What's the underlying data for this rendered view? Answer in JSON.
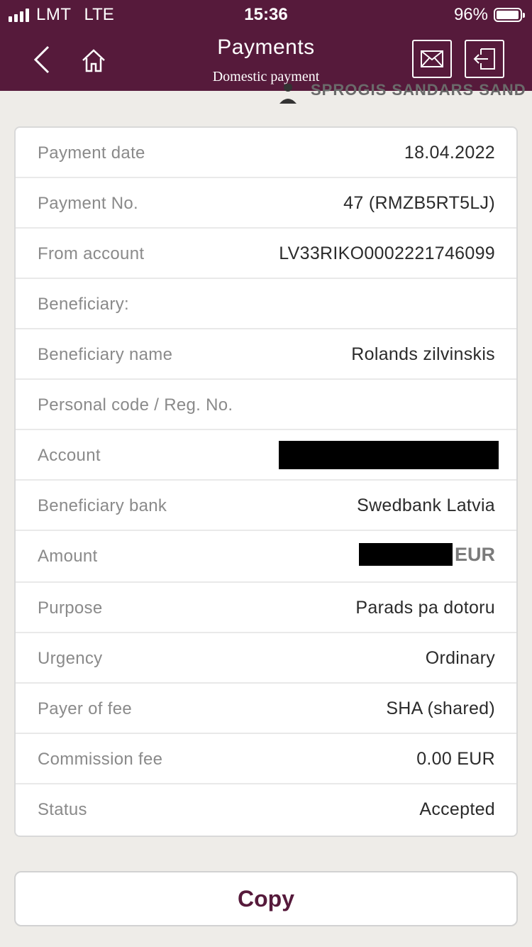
{
  "status_bar": {
    "carrier": "LMT",
    "network": "LTE",
    "time": "15:36",
    "battery": "96%",
    "battery_level": 0.96
  },
  "header": {
    "title": "Payments",
    "subtitle": "Domestic payment",
    "back_icon": "chevron-left-icon",
    "home_icon": "home-icon",
    "mail_icon": "envelope-icon",
    "logout_icon": "logout-icon",
    "background_color": "#561a3b"
  },
  "peek_text": "SPROGIS SANDARS SAND",
  "details": [
    {
      "label": "Payment date",
      "value": "18.04.2022"
    },
    {
      "label": "Payment No.",
      "value": "47 (RMZB5RT5LJ)"
    },
    {
      "label": "From account",
      "value": "LV33RIKO0002221746099"
    },
    {
      "label": "Beneficiary:",
      "value": ""
    },
    {
      "label": "Beneficiary name",
      "value": "Rolands zilvinskis"
    },
    {
      "label": "Personal code / Reg. No.",
      "value": ""
    },
    {
      "label": "Account",
      "value": ""
    },
    {
      "label": "Beneficiary bank",
      "value": "Swedbank Latvia"
    },
    {
      "label": "Amount",
      "value": "EUR"
    },
    {
      "label": "Purpose",
      "value": "Parads pa dotoru"
    },
    {
      "label": "Urgency",
      "value": "Ordinary"
    },
    {
      "label": "Payer of fee",
      "value": "SHA (shared)"
    },
    {
      "label": "Commission fee",
      "value": "0.00 EUR"
    },
    {
      "label": "Status",
      "value": "Accepted"
    }
  ],
  "copy_button": "Copy"
}
